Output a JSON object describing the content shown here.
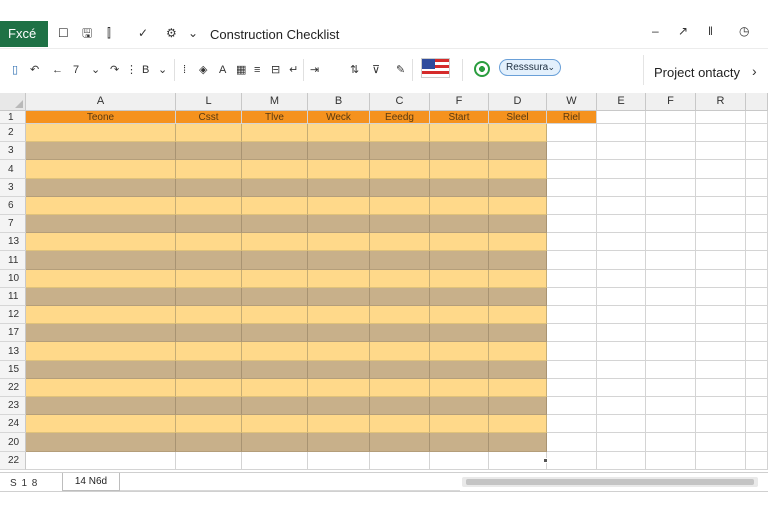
{
  "app": {
    "badge": "Fxcé",
    "title": "Construction Checklist"
  },
  "titlebar_icons": [
    {
      "name": "square-icon",
      "glyph": "☐"
    },
    {
      "name": "save-icon",
      "glyph": "🖫"
    },
    {
      "name": "format-icon",
      "glyph": "⫿"
    },
    {
      "name": "check-icon",
      "glyph": "✓"
    },
    {
      "name": "settings-icon",
      "glyph": "⚙"
    },
    {
      "name": "chevron-down-icon",
      "glyph": "⌄"
    }
  ],
  "window_controls": [
    {
      "name": "minimize-icon",
      "glyph": "–"
    },
    {
      "name": "arrow-icon",
      "glyph": "↗"
    },
    {
      "name": "pause-icon",
      "glyph": "‖"
    },
    {
      "name": "clock-icon",
      "glyph": "◷"
    }
  ],
  "ribbon": {
    "icons": [
      {
        "name": "paste-icon",
        "glyph": "▯"
      },
      {
        "name": "undo-icon",
        "glyph": "↶"
      },
      {
        "name": "back-arrow-icon",
        "glyph": "←"
      },
      {
        "name": "italic-icon",
        "glyph": "7"
      },
      {
        "name": "chevron-down-icon",
        "glyph": "⌄"
      },
      {
        "name": "redo-icon",
        "glyph": "↷"
      },
      {
        "name": "brush-icon",
        "glyph": "⋮"
      },
      {
        "name": "bold-icon",
        "glyph": "B"
      },
      {
        "name": "chevron-down-icon",
        "glyph": "⌄"
      },
      {
        "name": "align-left-icon",
        "glyph": "⁞"
      },
      {
        "name": "fill-icon",
        "glyph": "◈"
      },
      {
        "name": "font-color-icon",
        "glyph": "A"
      },
      {
        "name": "border-icon",
        "glyph": "▦"
      },
      {
        "name": "align-icon",
        "glyph": "≡"
      },
      {
        "name": "merge-icon",
        "glyph": "⊟"
      },
      {
        "name": "wrap-icon",
        "glyph": "↵"
      },
      {
        "name": "indent-icon",
        "glyph": "⇥"
      },
      {
        "name": "sort-icon",
        "glyph": "⇅"
      },
      {
        "name": "filter-icon",
        "glyph": "⊽"
      },
      {
        "name": "pen-icon",
        "glyph": "✎"
      }
    ],
    "resource_pill": "Resssura",
    "project_label": "Project ontacty",
    "project_chevron": "›"
  },
  "grid": {
    "corner": "",
    "columns": [
      "A",
      "L",
      "M",
      "B",
      "C",
      "F",
      "D",
      "W",
      "E",
      "F",
      "R",
      ""
    ],
    "header_row_label": "1",
    "headers": [
      "Teone",
      "Csst",
      "Tlve",
      "Weck",
      "Eeedg",
      "Start",
      "Sleel",
      "Riel"
    ],
    "row_labels": [
      "2",
      "3",
      "4",
      "3",
      "6",
      "7",
      "13",
      "11",
      "10",
      "11",
      "12",
      "17",
      "13",
      "15",
      "22",
      "23",
      "24",
      "20",
      "22"
    ]
  },
  "bottom": {
    "status": "S 1 8",
    "sheet_tab": "14 N6d"
  },
  "colors": {
    "app_green": "#1e7145",
    "header_orange": "#f5921e",
    "row_light": "#ffd98a",
    "row_dark": "#c8b08a"
  }
}
